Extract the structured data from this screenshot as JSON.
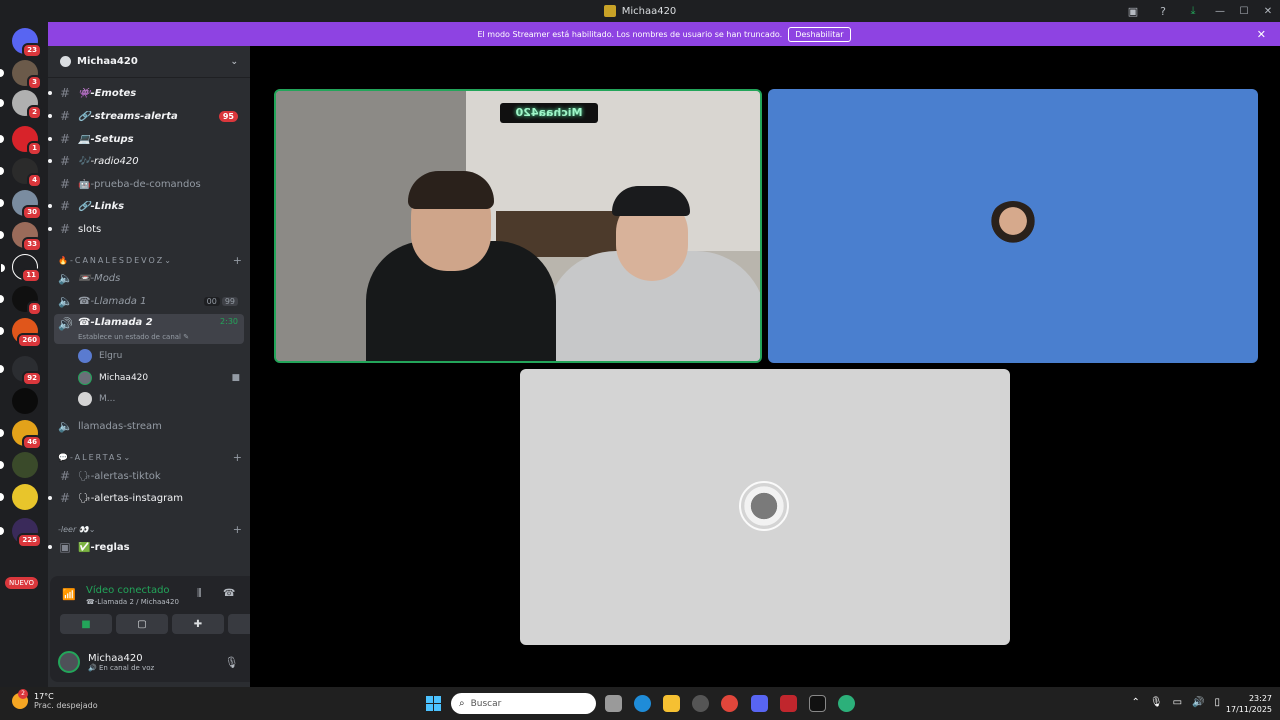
{
  "window": {
    "title": "Michaa420"
  },
  "banner": {
    "text": "El modo Streamer está habilitado. Los nombres de usuario se han truncado.",
    "button": "Deshabilitar"
  },
  "server_badges": [
    "23",
    "3",
    "2",
    "1",
    "4",
    "30",
    "33",
    "11",
    "8",
    "260",
    "92",
    "",
    "46",
    "",
    "",
    "225"
  ],
  "nuevo_label": "NUEVO",
  "guild": {
    "name": "Michaa420"
  },
  "channels": [
    {
      "name": "👾-Emotes"
    },
    {
      "name": "🔗-streams-alerta",
      "mentions": "95"
    },
    {
      "name": "💻-Setups"
    },
    {
      "name": "🎶-radio420"
    },
    {
      "name": "🤖-prueba-de-comandos"
    },
    {
      "name": "🔗-Links"
    },
    {
      "name": "slots"
    }
  ],
  "category_voice": "-CANALESDEVOZ",
  "voice_channels": [
    {
      "name": "📼-Mods"
    },
    {
      "name": "☎-Llamada 1",
      "counts": [
        "00",
        "99"
      ]
    },
    {
      "name": "☎-Llamada 2",
      "time": "2:30"
    }
  ],
  "channel_status_prompt": "Establece un estado de canal",
  "voice_users": [
    "Elgru",
    "Michaa420",
    "M..."
  ],
  "channel_stream": "llamadas-stream",
  "category_alerts": "-ALERTAS",
  "alert_channels": [
    {
      "name": "🗣-alertas-tiktok"
    },
    {
      "name": "🗣-alertas-instagram"
    }
  ],
  "category_leer": "-leer 👀",
  "leer_channels": [
    {
      "name": "✅-reglas"
    }
  ],
  "voice_panel": {
    "title": "Vídeo conectado",
    "subtitle": "☎-Llamada 2 / Michaa420"
  },
  "user": {
    "name": "Michaa420",
    "status": "En canal de voz"
  },
  "camera_overlay": "Michaa420",
  "taskbar": {
    "temp": "17°C",
    "weather": "Prac. despejado",
    "weather_badge": "2",
    "search_placeholder": "Buscar",
    "time": "23:27",
    "date": "17/11/2025"
  },
  "colors": {
    "streamer_banner": "#8e43e2",
    "speaking_border": "#23a55a",
    "blue_tile": "#4a7fcf",
    "grey_tile": "#d4d4d4"
  }
}
